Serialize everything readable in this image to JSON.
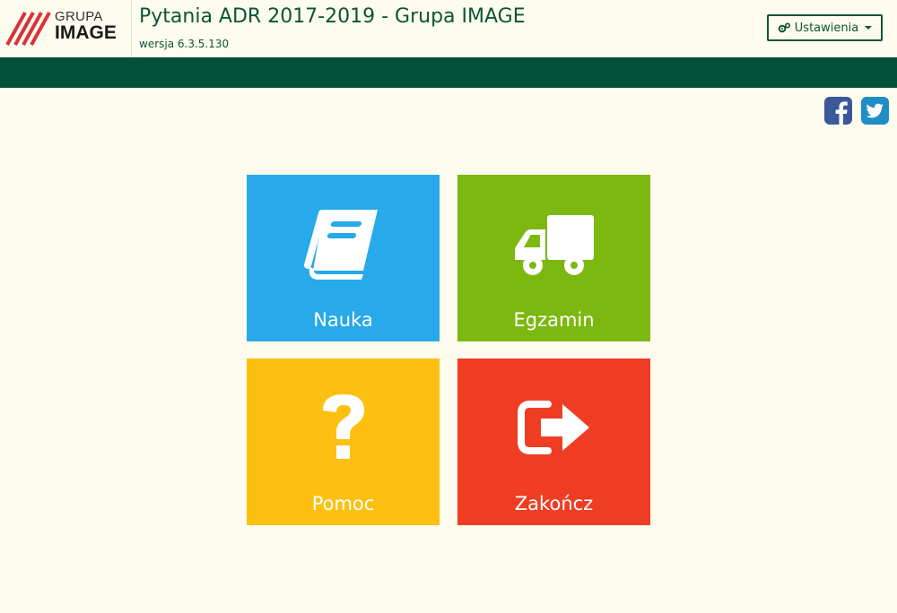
{
  "logo": {
    "line1": "GRUPA",
    "line2": "IMAGE"
  },
  "header": {
    "title": "Pytania ADR 2017-2019 - Grupa IMAGE",
    "version": "wersja 6.3.5.130",
    "settings_label": "Ustawienia"
  },
  "social": {
    "facebook_icon": "facebook-icon",
    "twitter_icon": "twitter-icon"
  },
  "tiles": [
    {
      "label": "Nauka",
      "icon": "book-icon",
      "color": "#27a9ea"
    },
    {
      "label": "Egzamin",
      "icon": "truck-icon",
      "color": "#7cb80f"
    },
    {
      "label": "Pomoc",
      "icon": "question-icon",
      "color": "#fdc010"
    },
    {
      "label": "Zakończ",
      "icon": "exit-icon",
      "color": "#ef3d23"
    }
  ],
  "colors": {
    "background": "#fefcee",
    "brand_green": "#035138",
    "text_green": "#0c5438"
  }
}
